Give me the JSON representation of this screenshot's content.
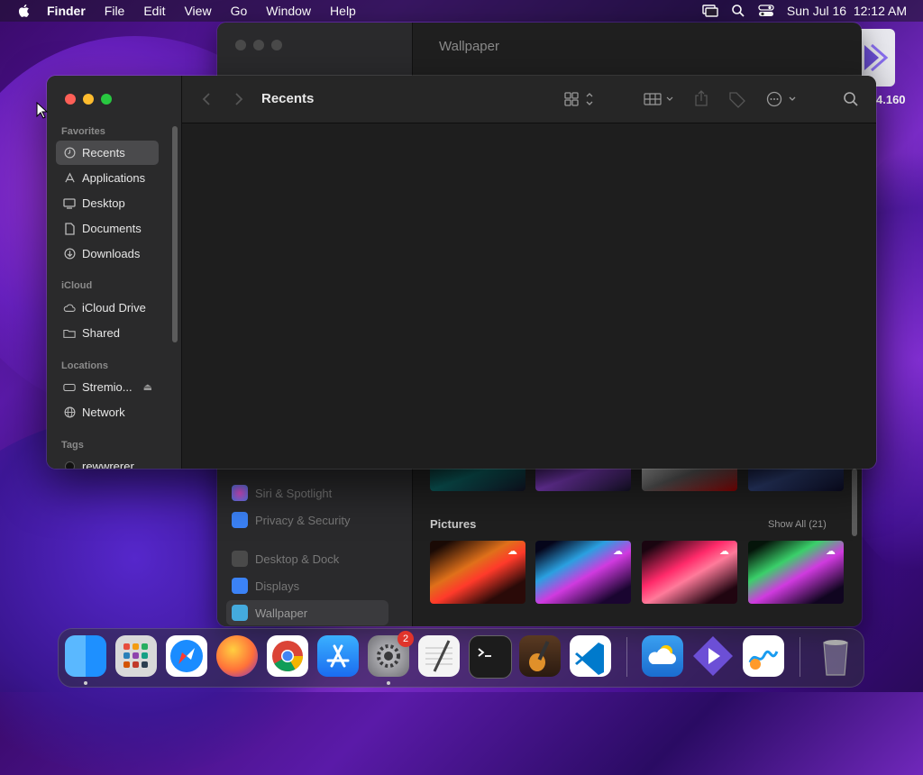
{
  "menubar": {
    "app": "Finder",
    "items": [
      "File",
      "Edit",
      "View",
      "Go",
      "Window",
      "Help"
    ],
    "datetime": "Sun Jul 16  12:12 AM"
  },
  "desktop": {
    "icon_label": "4.160"
  },
  "settings": {
    "title": "Wallpaper",
    "sidebar_items": [
      {
        "label": "Siri & Spotlight",
        "icon": "siri-icon",
        "color": "#a44fd6"
      },
      {
        "label": "Privacy & Security",
        "icon": "hand-icon",
        "color": "#3b82f6"
      },
      {
        "label": "Desktop & Dock",
        "icon": "dock-icon",
        "color": "#555555"
      },
      {
        "label": "Displays",
        "icon": "sun-icon",
        "color": "#3b82f6"
      },
      {
        "label": "Wallpaper",
        "icon": "wallpaper-icon",
        "color": "#44aadd"
      }
    ],
    "pictures_title": "Pictures",
    "show_all": "Show All (21)"
  },
  "finder": {
    "title": "Recents",
    "sections": {
      "favorites": "Favorites",
      "icloud": "iCloud",
      "locations": "Locations",
      "tags": "Tags"
    },
    "favorites": [
      {
        "label": "Recents",
        "icon": "clock-icon"
      },
      {
        "label": "Applications",
        "icon": "applications-icon"
      },
      {
        "label": "Desktop",
        "icon": "desktop-icon"
      },
      {
        "label": "Documents",
        "icon": "document-icon"
      },
      {
        "label": "Downloads",
        "icon": "download-icon"
      }
    ],
    "icloud": [
      {
        "label": "iCloud Drive",
        "icon": "cloud-icon"
      },
      {
        "label": "Shared",
        "icon": "shared-folder-icon"
      }
    ],
    "locations": [
      {
        "label": "Stremio...",
        "icon": "disk-icon"
      },
      {
        "label": "Network",
        "icon": "globe-icon"
      }
    ],
    "tags": [
      {
        "label": "rewwrerer",
        "icon": "tag-dot-icon"
      }
    ]
  },
  "dock": {
    "apps": [
      {
        "name": "Finder",
        "icon": "finder-icon",
        "color": "#1e90ff",
        "running": true
      },
      {
        "name": "Launchpad",
        "icon": "launchpad-icon",
        "color": "#d9d9d9",
        "running": false
      },
      {
        "name": "Safari",
        "icon": "safari-icon",
        "color": "#ffffff",
        "running": false
      },
      {
        "name": "Firefox",
        "icon": "firefox-icon",
        "color": "#ff7139",
        "running": false
      },
      {
        "name": "Chrome",
        "icon": "chrome-icon",
        "color": "#ffffff",
        "running": false
      },
      {
        "name": "App Store",
        "icon": "app-store-icon",
        "color": "#1a8cff",
        "running": false
      },
      {
        "name": "System Settings",
        "icon": "settings-icon",
        "color": "#8e8e93",
        "running": true,
        "badge": "2"
      },
      {
        "name": "TextEdit",
        "icon": "textedit-icon",
        "color": "#f4f4f4",
        "running": false
      },
      {
        "name": "Terminal",
        "icon": "terminal-icon",
        "color": "#1c1c1c",
        "running": false
      },
      {
        "name": "GarageBand",
        "icon": "garageband-icon",
        "color": "#3a2a20",
        "running": false
      },
      {
        "name": "VS Code",
        "icon": "vscode-icon",
        "color": "#ffffff",
        "running": false
      },
      {
        "name": "Weather",
        "icon": "weather-icon",
        "color": "#2f8de4",
        "running": false
      },
      {
        "name": "Stremio",
        "icon": "stremio-icon",
        "color": "#6c4fd6",
        "running": false
      },
      {
        "name": "Freeform",
        "icon": "freeform-icon",
        "color": "#ffffff",
        "running": false
      },
      {
        "name": "Trash",
        "icon": "trash-icon",
        "color": "#9a9a9a",
        "running": false
      }
    ]
  }
}
